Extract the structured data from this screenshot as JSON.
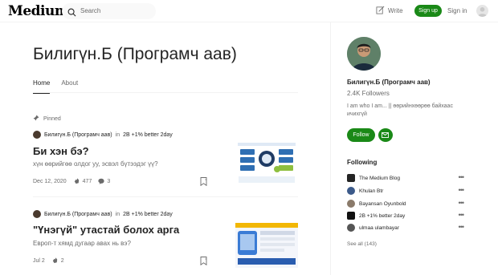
{
  "header": {
    "logo": "Medium",
    "search_placeholder": "Search",
    "write_label": "Write",
    "signup_label": "Sign up",
    "signin_label": "Sign in"
  },
  "profile": {
    "title": "Билигүн.Б (Програмч аав)",
    "tabs": [
      {
        "label": "Home",
        "active": true
      },
      {
        "label": "About",
        "active": false
      }
    ],
    "pinned_label": "Pinned"
  },
  "posts": [
    {
      "author": "Билигүн.Б (Програмч аав)",
      "in_label": "in",
      "publication": "2B +1% better 2day",
      "title": "Би хэн бэ?",
      "subtitle": "хүн өөрийгөө олдог уу, эсвэл бүтээдэг үү?",
      "date": "Dec 12, 2020",
      "claps": "477",
      "comments": "3"
    },
    {
      "author": "Билигүн.Б (Програмч аав)",
      "in_label": "in",
      "publication": "2B +1% better 2day",
      "title": "\"Үнэгүй\" утастай болох арга",
      "subtitle": "Европ-т хямд дугаар авах нь вэ?",
      "date": "Jul 2",
      "claps": "2",
      "comments": ""
    }
  ],
  "sidebar": {
    "name": "Билигүн.Б (Програмч аав)",
    "followers": "2.4K Followers",
    "bio": "I am who I am... || өөрийнхөөрөө байхаас ичихгүй",
    "follow_label": "Follow",
    "following_heading": "Following",
    "following": [
      {
        "name": "The Medium Blog",
        "color": "#242424"
      },
      {
        "name": "Khulan Btr",
        "color": "#3c5a8a"
      },
      {
        "name": "Bayansan Oyunbold",
        "color": "#8a7a6a"
      },
      {
        "name": "2B +1% better 2day",
        "color": "#111111"
      },
      {
        "name": "ulmaa ulambayar",
        "color": "#555555"
      }
    ],
    "see_all": "See all (143)"
  },
  "colors": {
    "accent_green": "#1a8917",
    "text_primary": "#242424",
    "text_muted": "#6b6b6b"
  }
}
